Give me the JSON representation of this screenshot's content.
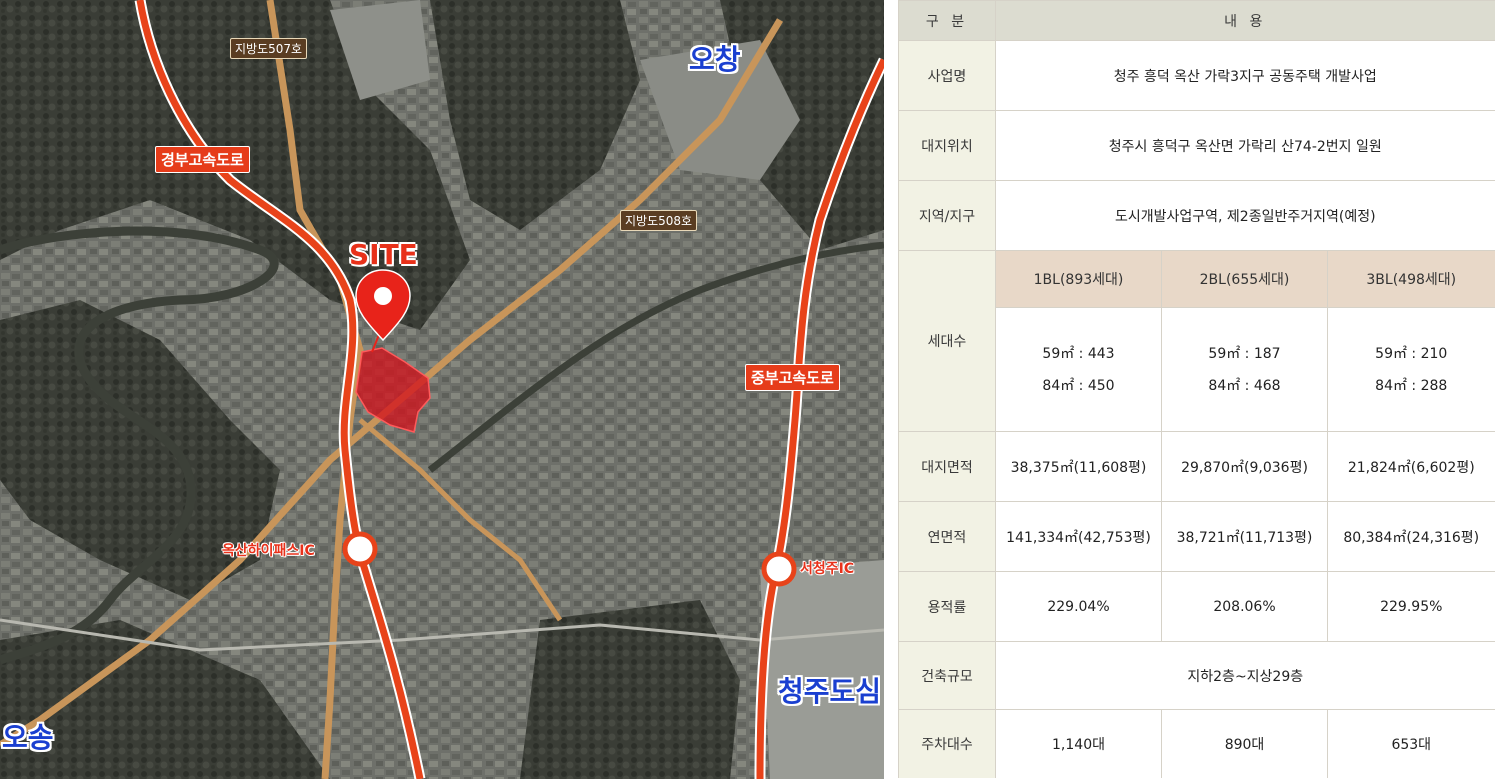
{
  "map": {
    "labels": {
      "site": "SITE",
      "ochang": "오창",
      "osong": "오송",
      "cheongju_dosim": "청주도심",
      "gyeongbu": "경부고속도로",
      "jungbu": "중부고속도로",
      "local507": "지방도507호",
      "local508": "지방도508호",
      "oksan_ic": "옥산하이패스IC",
      "seocheongju_ic": "서청주IC"
    },
    "colors": {
      "highway": "#e8431a",
      "local_road": "#c8955a",
      "site_area": "#d2141e",
      "marker": "#e8231a"
    }
  },
  "table": {
    "header": {
      "col1": "구 분",
      "col2": "내 용"
    },
    "project_name": {
      "label": "사업명",
      "value": "청주 흥덕 옥산 가락3지구 공동주택 개발사업"
    },
    "location": {
      "label": "대지위치",
      "value": "청주시 흥덕구 옥산면 가락리 산74-2번지 일원"
    },
    "zone": {
      "label": "지역/지구",
      "value": "도시개발사업구역, 제2종일반주거지역(예정)"
    },
    "units": {
      "label": "세대수",
      "blocks": [
        {
          "name": "1BL(893세대)",
          "line1": "59㎡ : 443",
          "line2": "84㎡ : 450"
        },
        {
          "name": "2BL(655세대)",
          "line1": "59㎡ : 187",
          "line2": "84㎡ : 468"
        },
        {
          "name": "3BL(498세대)",
          "line1": "59㎡ : 210",
          "line2": "84㎡ : 288"
        }
      ]
    },
    "site_area": {
      "label": "대지면적",
      "values": [
        "38,375㎡(11,608평)",
        "29,870㎡(9,036평)",
        "21,824㎡(6,602평)"
      ]
    },
    "floor_area": {
      "label": "연면적",
      "values": [
        "141,334㎡(42,753평)",
        "38,721㎡(11,713평)",
        "80,384㎡(24,316평)"
      ]
    },
    "far": {
      "label": "용적률",
      "values": [
        "229.04%",
        "208.06%",
        "229.95%"
      ]
    },
    "scale": {
      "label": "건축규모",
      "value": "지하2층~지상29층"
    },
    "parking": {
      "label": "주차대수",
      "values": [
        "1,140대",
        "890대",
        "653대"
      ]
    }
  }
}
